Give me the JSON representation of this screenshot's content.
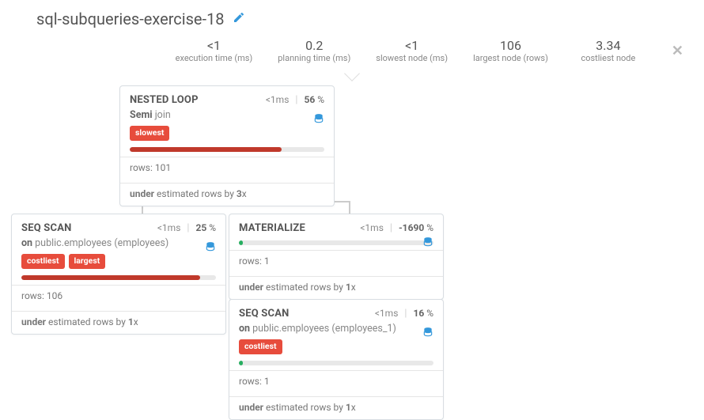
{
  "title": "sql-subqueries-exercise-18",
  "stats": [
    {
      "val": "<1",
      "lbl": "execution time (ms)"
    },
    {
      "val": "0.2",
      "lbl": "planning time (ms)"
    },
    {
      "val": "<1",
      "lbl": "slowest node (ms)"
    },
    {
      "val": "106",
      "lbl": "largest node (rows)"
    },
    {
      "val": "3.34",
      "lbl": "costliest node"
    }
  ],
  "nodes": {
    "n0": {
      "name": "NESTED LOOP",
      "time": "<1ms",
      "pct": "56",
      "sub_b": "Semi",
      "sub_rest": " join",
      "tags": [
        "slowest"
      ],
      "bar_color": "red",
      "bar_pct": 78,
      "rows": "rows: 101",
      "est_pre": "under",
      "est_mid": " estimated rows by ",
      "est_b": "3",
      "est_suf": "x"
    },
    "n1": {
      "name": "SEQ SCAN",
      "time": "<1ms",
      "pct": "25",
      "sub_b": "on",
      "sub_rest": " public.employees (employees)",
      "tags": [
        "costliest",
        "largest"
      ],
      "bar_color": "red",
      "bar_pct": 92,
      "rows": "rows: 106",
      "est_pre": "under",
      "est_mid": " estimated rows by ",
      "est_b": "1",
      "est_suf": "x"
    },
    "n2": {
      "name": "MATERIALIZE",
      "time": "<1ms",
      "pct": "-1690",
      "bar_color": "green",
      "bar_pct": 2,
      "rows": "rows: 1",
      "est_pre": "under",
      "est_mid": " estimated rows by ",
      "est_b": "1",
      "est_suf": "x"
    },
    "n3": {
      "name": "SEQ SCAN",
      "time": "<1ms",
      "pct": "16",
      "sub_b": "on",
      "sub_rest": " public.employees (employees_1)",
      "tags": [
        "costliest"
      ],
      "bar_color": "green",
      "bar_pct": 2,
      "rows": "rows: 1",
      "est_pre": "under",
      "est_mid": " estimated rows by ",
      "est_b": "1",
      "est_suf": "x"
    }
  }
}
